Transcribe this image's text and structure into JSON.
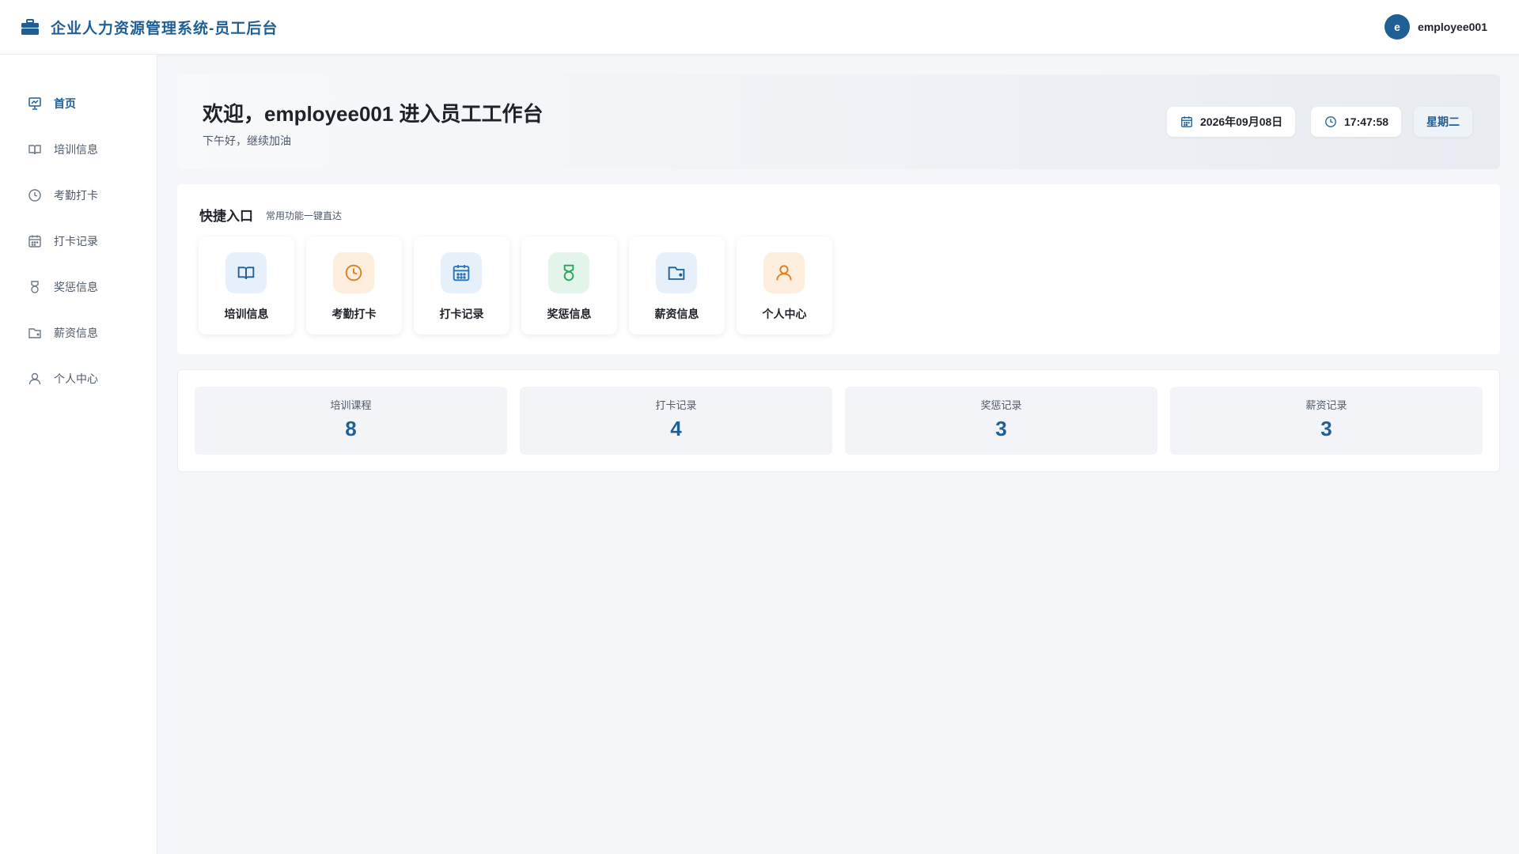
{
  "app": {
    "title": "企业人力资源管理系统-员工后台",
    "brand_icon": "briefcase-icon",
    "brand_color": "#1f5f96"
  },
  "user": {
    "avatar_letter": "e",
    "name": "employee001"
  },
  "sidebar": {
    "items": [
      {
        "label": "首页",
        "icon": "chart-board-icon",
        "active": true
      },
      {
        "label": "培训信息",
        "icon": "book-icon",
        "active": false
      },
      {
        "label": "考勤打卡",
        "icon": "clock-icon",
        "active": false
      },
      {
        "label": "打卡记录",
        "icon": "calendar-icon",
        "active": false
      },
      {
        "label": "奖惩信息",
        "icon": "medal-icon",
        "active": false
      },
      {
        "label": "薪资信息",
        "icon": "wallet-icon",
        "active": false
      },
      {
        "label": "个人中心",
        "icon": "user-icon",
        "active": false
      }
    ]
  },
  "welcome": {
    "title": "欢迎，employee001 进入员工工作台",
    "subtitle": "下午好，继续加油",
    "date": "2026年09月08日",
    "time": "17:47:58",
    "weekday": "星期二"
  },
  "quick": {
    "title": "快捷入口",
    "subtitle": "常用功能一键直达",
    "items": [
      {
        "label": "培训信息",
        "icon": "book-icon",
        "bg": "#e6f0fa",
        "color": "#1f5f96"
      },
      {
        "label": "考勤打卡",
        "icon": "clock-icon",
        "bg": "#fdeedd",
        "color": "#e07b1f"
      },
      {
        "label": "打卡记录",
        "icon": "calendar-icon",
        "bg": "#e6f0fa",
        "color": "#2a73b8"
      },
      {
        "label": "奖惩信息",
        "icon": "medal-icon",
        "bg": "#e3f5ea",
        "color": "#23a55a"
      },
      {
        "label": "薪资信息",
        "icon": "wallet-icon",
        "bg": "#e6f0fa",
        "color": "#1f5f96"
      },
      {
        "label": "个人中心",
        "icon": "user-icon",
        "bg": "#fdeedd",
        "color": "#e07b1f"
      }
    ]
  },
  "stats": [
    {
      "label": "培训课程",
      "value": "8"
    },
    {
      "label": "打卡记录",
      "value": "4"
    },
    {
      "label": "奖惩记录",
      "value": "3"
    },
    {
      "label": "薪资记录",
      "value": "3"
    }
  ]
}
